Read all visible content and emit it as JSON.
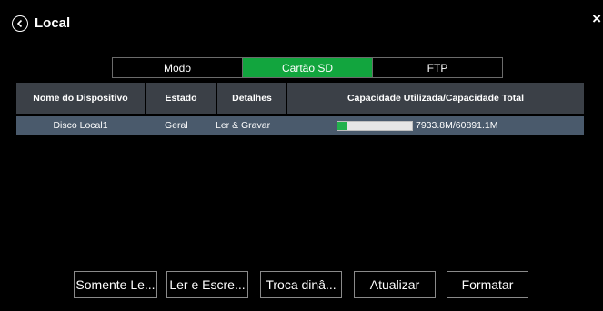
{
  "header": {
    "title": "Local"
  },
  "tabs": [
    {
      "label": "Modo",
      "active": false
    },
    {
      "label": "Cartão SD",
      "active": true
    },
    {
      "label": "FTP",
      "active": false
    }
  ],
  "table": {
    "columns": [
      "Nome do Dispositivo",
      "Estado",
      "Detalhes",
      "Capacidade Utilizada/Capacidade Total"
    ],
    "rows": [
      {
        "name": "Disco Local1",
        "state": "Geral",
        "details": "Ler & Gravar",
        "capacity": "7933.8M/60891.1M",
        "usage_fraction": 0.13
      }
    ]
  },
  "buttons": {
    "read_only": "Somente Le...",
    "read_write": "Ler e Escre...",
    "hot_swap": "Troca dinâ...",
    "refresh": "Atualizar",
    "format": "Formatar"
  },
  "colors": {
    "accent": "#12a53e",
    "row_bg": "#4a5a6c",
    "header_bg": "#3b4047"
  },
  "icons": {
    "back": "circle-chevron-left-icon",
    "close": "close-icon"
  }
}
